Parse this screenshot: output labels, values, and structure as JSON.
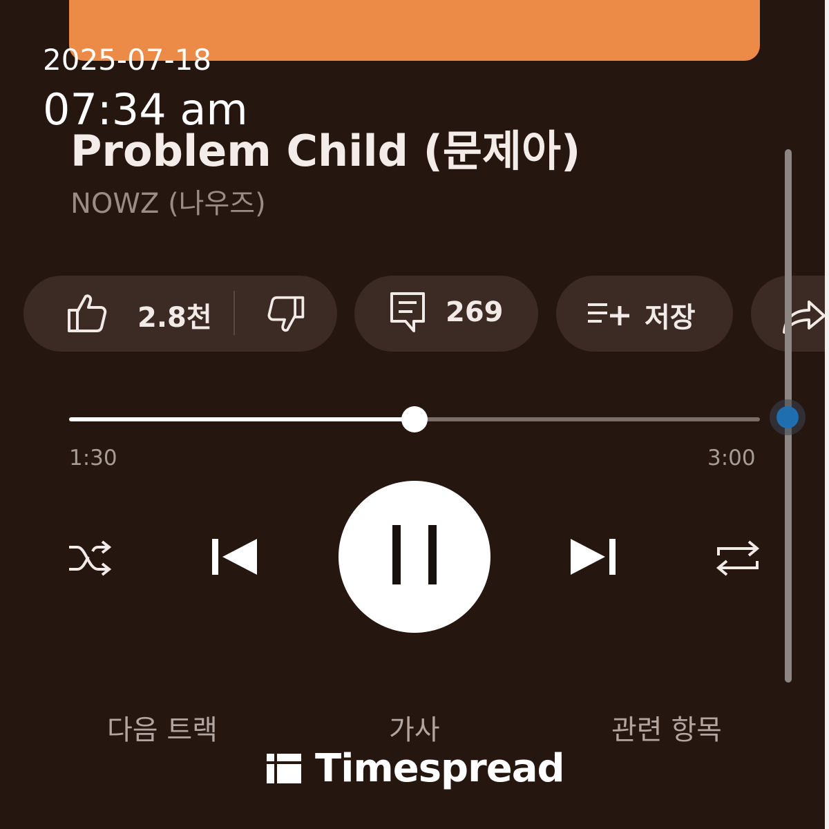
{
  "overlay": {
    "date": "2025-07-18",
    "time": "07:34 am"
  },
  "track": {
    "title": "Problem Child (문제아)",
    "artist": "NOWZ (나우즈)"
  },
  "actions": {
    "likes": "2.8천",
    "comments": "269",
    "save_label": "저장"
  },
  "playback": {
    "current_time": "1:30",
    "total_time": "3:00",
    "progress_fraction": 0.5
  },
  "bottom_tabs": {
    "next_track": "다음 트랙",
    "lyrics": "가사",
    "related": "관련 항목"
  },
  "watermark": {
    "brand": "Timespread"
  },
  "colors": {
    "background": "#251610",
    "album_accent": "#ec8b47",
    "pill": "#3c2b25",
    "scroll_thumb": "#1f6fb0"
  }
}
